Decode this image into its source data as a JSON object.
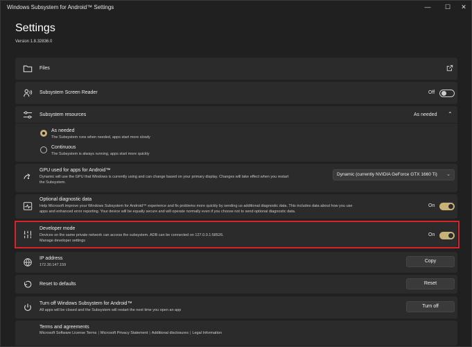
{
  "window": {
    "title": "Windows Subsystem for Android™ Settings",
    "controls": {
      "minimize": "—",
      "maximize": "☐",
      "close": "✕"
    }
  },
  "header": {
    "title": "Settings",
    "version": "Version 1.8.32836.0"
  },
  "files": {
    "label": "Files",
    "icon": "folder-icon",
    "action_icon": "open-external-icon"
  },
  "screen_reader": {
    "label": "Subsystem Screen Reader",
    "icon": "screen-reader-icon",
    "state": "Off"
  },
  "resources": {
    "label": "Subsystem resources",
    "icon": "sliders-icon",
    "value": "As needed",
    "options": [
      {
        "label": "As needed",
        "desc": "The Subsystem runs when needed, apps start more slowly",
        "selected": true
      },
      {
        "label": "Continuous",
        "desc": "The Subsystem is always running, apps start more quickly",
        "selected": false
      }
    ]
  },
  "gpu": {
    "label": "GPU used for apps for Android™",
    "icon": "gpu-icon",
    "desc1": "Dynamic will use the GPU that Windows is currently using and can change based on your primary display. Changes will take effect when you restart",
    "desc2": "the Subsystem.",
    "selected": "Dynamic (currently NVIDIA GeForce GTX 1660 Ti)"
  },
  "diagnostics": {
    "label": "Optional diagnostic data",
    "icon": "diagnostic-icon",
    "desc1": "Help Microsoft improve your Windows Subsystem for Android™ experience and fix problems more quickly by sending us additional diagnostic data. This includes data about how you use",
    "desc2": "apps and enhanced error reporting. Your device will be equally secure and will operate normally even if you choose not to send optional diagnostic data.",
    "state": "On"
  },
  "developer": {
    "label": "Developer mode",
    "icon": "developer-icon",
    "desc": "Devices on the same private network can access the subsystem. ADB can be connected on 127.0.0.1:58526.",
    "link": "Manage developer settings",
    "state": "On"
  },
  "ip": {
    "label": "IP address",
    "icon": "globe-icon",
    "value": "172.30.147.159",
    "button": "Copy"
  },
  "reset": {
    "label": "Reset to defaults",
    "icon": "reset-icon",
    "button": "Reset"
  },
  "turnoff": {
    "label": "Turn off Windows Subsystem for Android™",
    "icon": "power-icon",
    "desc": "All apps will be closed and the Subsystem will restart the next time you open an app",
    "button": "Turn off"
  },
  "terms": {
    "label": "Terms and agreements",
    "links": [
      "Microsoft Software License Terms",
      "Microsoft Privacy Statement",
      "Additional disclosures",
      "Legal Information"
    ]
  },
  "colors": {
    "accent": "#c8b27a",
    "highlight": "#d8232a",
    "card": "#2b2b2b",
    "background": "#202020"
  }
}
